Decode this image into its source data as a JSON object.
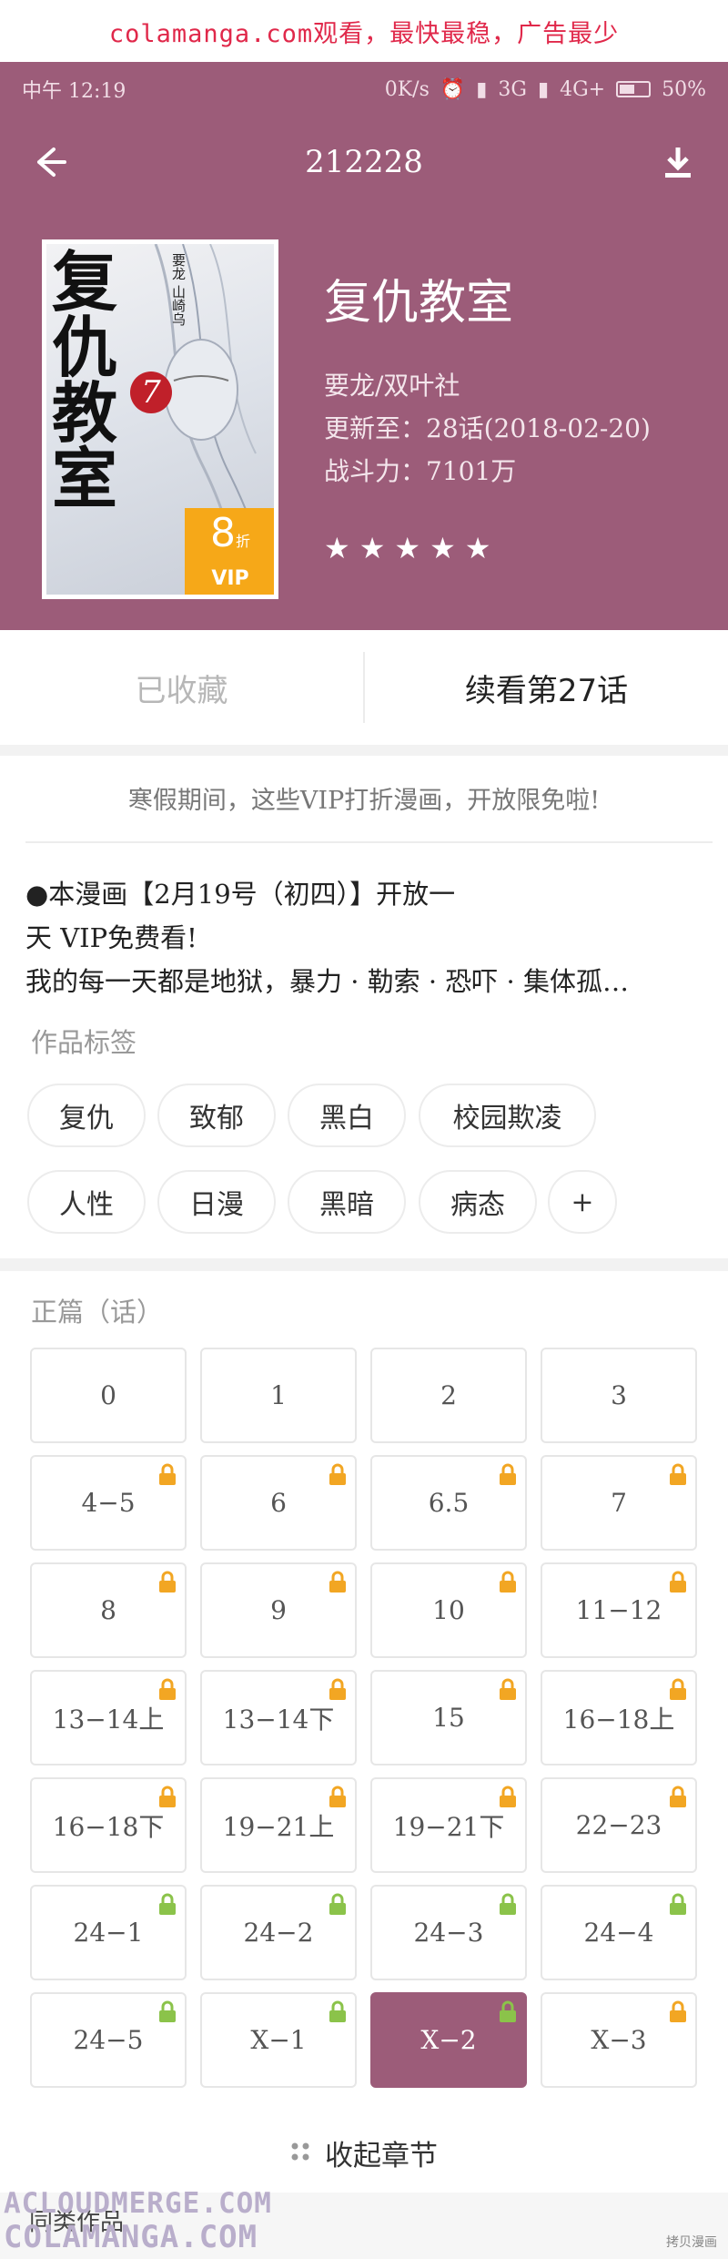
{
  "banner": "colamanga.com观看，最快最稳，广告最少",
  "status": {
    "time": "中午 12:19",
    "speed": "0K/s",
    "network1": "3G",
    "network2": "4G+",
    "battery": "50%"
  },
  "nav": {
    "title": "212228"
  },
  "book": {
    "cover_title": "复仇教室",
    "cover_num": "7",
    "cover_author": "要龙 山崎乌",
    "cover_discount": "8",
    "cover_discount_unit": "折",
    "cover_vip": "VIP",
    "title": "复仇教室",
    "author": "要龙/双叶社",
    "update": "更新至：28话(2018-02-20)",
    "power": "战斗力：7101万",
    "rating": 5
  },
  "actions": {
    "collected": "已收藏",
    "continue": "续看第27话"
  },
  "promo": "寒假期间，这些VIP打折漫画，开放限免啦!",
  "description": [
    "●本漫画【2月19号（初四）】开放一",
    "天  VIP免费看!",
    "我的每一天都是地狱，暴力 · 勒索 · 恐吓 · 集体孤…"
  ],
  "tags_label": "作品标签",
  "tags": [
    "复仇",
    "致郁",
    "黑白",
    "校园欺凌",
    "人性",
    "日漫",
    "黑暗",
    "病态",
    "+"
  ],
  "chapters_label": "正篇（话）",
  "chapters": [
    {
      "label": "0",
      "lock": "none"
    },
    {
      "label": "1",
      "lock": "none"
    },
    {
      "label": "2",
      "lock": "none"
    },
    {
      "label": "3",
      "lock": "none"
    },
    {
      "label": "4−5",
      "lock": "locked"
    },
    {
      "label": "6",
      "lock": "locked"
    },
    {
      "label": "6.5",
      "lock": "locked"
    },
    {
      "label": "7",
      "lock": "locked"
    },
    {
      "label": "8",
      "lock": "locked"
    },
    {
      "label": "9",
      "lock": "locked"
    },
    {
      "label": "10",
      "lock": "locked"
    },
    {
      "label": "11−12",
      "lock": "locked"
    },
    {
      "label": "13−14上",
      "lock": "locked"
    },
    {
      "label": "13−14下",
      "lock": "locked"
    },
    {
      "label": "15",
      "lock": "locked"
    },
    {
      "label": "16−18上",
      "lock": "locked"
    },
    {
      "label": "16−18下",
      "lock": "locked"
    },
    {
      "label": "19−21上",
      "lock": "locked"
    },
    {
      "label": "19−21下",
      "lock": "locked"
    },
    {
      "label": "22−23",
      "lock": "locked"
    },
    {
      "label": "24−1",
      "lock": "unlocked"
    },
    {
      "label": "24−2",
      "lock": "unlocked"
    },
    {
      "label": "24−3",
      "lock": "unlocked"
    },
    {
      "label": "24−4",
      "lock": "unlocked"
    },
    {
      "label": "24−5",
      "lock": "unlocked"
    },
    {
      "label": "X−1",
      "lock": "unlocked"
    },
    {
      "label": "X−2",
      "lock": "unlocked",
      "active": true
    },
    {
      "label": "X−3",
      "lock": "locked"
    }
  ],
  "collapse": "收起章节",
  "bottom_partial": "同类作品",
  "watermarks": [
    "ACLOUDMERGE.COM",
    "COLAMANGA.COM",
    "拷贝漫画"
  ],
  "colors": {
    "accent": "#9c5c79",
    "lock_locked": "#f2a623",
    "lock_unlocked": "#8bc34a"
  }
}
